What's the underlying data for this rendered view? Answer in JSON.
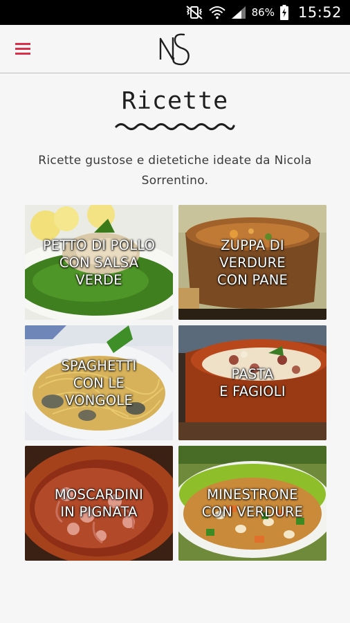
{
  "status_bar": {
    "battery": "86%",
    "time": "15:52",
    "icons": [
      "vibrate-mute-icon",
      "wifi-icon",
      "signal-icon",
      "battery-charging-icon"
    ]
  },
  "app_bar": {
    "menu_icon": "hamburger-menu-icon",
    "logo": "NS",
    "accent_color": "#d8304a"
  },
  "page": {
    "title": "Ricette",
    "subtitle": "Ricette gustose e dietetiche ideate da Nicola Sorrentino."
  },
  "recipes": [
    {
      "title": "PETTO DI POLLO\nCON SALSA\nVERDE"
    },
    {
      "title": "ZUPPA DI\nVERDURE\nCON PANE"
    },
    {
      "title": "SPAGHETTI\nCON LE\nVONGOLE"
    },
    {
      "title": "PASTA\nE FAGIOLI"
    },
    {
      "title": "MOSCARDINI\nIN PIGNATA"
    },
    {
      "title": "MINESTRONE\nCON VERDURE"
    }
  ]
}
